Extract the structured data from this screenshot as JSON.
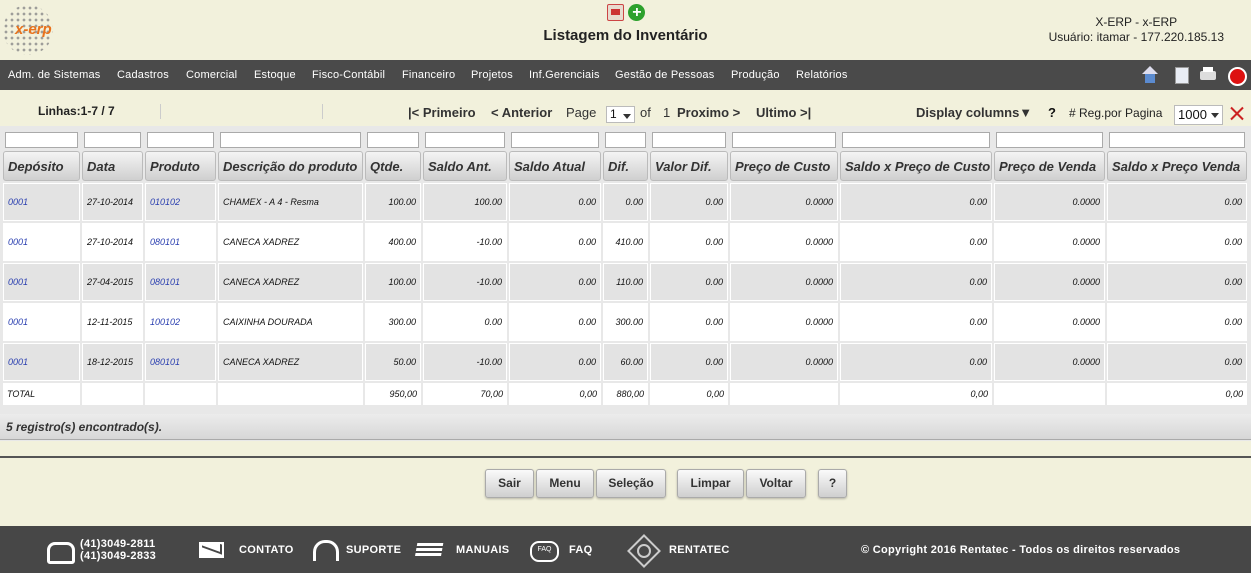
{
  "header": {
    "brand": "x-erp",
    "title": "Listagem do Inventário",
    "user_line1": "X-ERP - x-ERP",
    "user_line2": "Usuário: itamar - 177.220.185.13"
  },
  "menu": [
    "Adm. de Sistemas",
    "Cadastros",
    "Comercial",
    "Estoque",
    "Fisco-Contábil",
    "Financeiro",
    "Projetos",
    "Inf.Gerenciais",
    "Gestão de Pessoas",
    "Produção",
    "Relatórios"
  ],
  "pager": {
    "lines": "Linhas:1-7 / 7",
    "first": "|< Primeiro",
    "prev": "< Anterior",
    "page_label": "Page",
    "page_value": "1",
    "of_label": "of",
    "total_pages": "1",
    "next": "Proximo >",
    "last": "Ultimo >|",
    "display_columns": "Display columns▼",
    "help": "?",
    "reg_label": "# Reg.por Pagina",
    "reg_value": "1000"
  },
  "columns": [
    "Depósito",
    "Data",
    "Produto",
    "Descrição do produto",
    "Qtde.",
    "Saldo Ant.",
    "Saldo Atual",
    "Dif.",
    "Valor Dif.",
    "Preço de Custo",
    "Saldo x Preço de Custo",
    "Preço de Venda",
    "Saldo x Preço Venda"
  ],
  "rows": [
    [
      "0001",
      "27-10-2014",
      "010102",
      "CHAMEX - A 4 - Resma",
      "100.00",
      "100.00",
      "0.00",
      "0.00",
      "0.00",
      "0.0000",
      "0.00",
      "0.0000",
      "0.00"
    ],
    [
      "0001",
      "27-10-2014",
      "080101",
      "CANECA XADREZ",
      "400.00",
      "-10.00",
      "0.00",
      "410.00",
      "0.00",
      "0.0000",
      "0.00",
      "0.0000",
      "0.00"
    ],
    [
      "0001",
      "27-04-2015",
      "080101",
      "CANECA XADREZ",
      "100.00",
      "-10.00",
      "0.00",
      "110.00",
      "0.00",
      "0.0000",
      "0.00",
      "0.0000",
      "0.00"
    ],
    [
      "0001",
      "12-11-2015",
      "100102",
      "CAIXINHA DOURADA",
      "300.00",
      "0.00",
      "0.00",
      "300.00",
      "0.00",
      "0.0000",
      "0.00",
      "0.0000",
      "0.00"
    ],
    [
      "0001",
      "18-12-2015",
      "080101",
      "CANECA XADREZ",
      "50.00",
      "-10.00",
      "0.00",
      "60.00",
      "0.00",
      "0.0000",
      "0.00",
      "0.0000",
      "0.00"
    ]
  ],
  "totals": [
    "TOTAL",
    "",
    "",
    "",
    "950,00",
    "70,00",
    "0,00",
    "880,00",
    "0,00",
    "",
    "0,00",
    "",
    "0,00"
  ],
  "found": "5 registro(s) encontrado(s).",
  "buttons": {
    "sair": "Sair",
    "menu": "Menu",
    "selecao": "Seleção",
    "limpar": "Limpar",
    "voltar": "Voltar",
    "help": "?"
  },
  "footer": {
    "phone1": "(41)3049-2811",
    "phone2": "(41)3049-2833",
    "contato": "CONTATO",
    "suporte": "SUPORTE",
    "manuais": "MANUAIS",
    "faq": "FAQ",
    "rentatec": "RENTATEC",
    "copyright": "© Copyright 2016 Rentatec - Todos os direitos reservados"
  },
  "colors": {
    "menubar": "#4a4a4a",
    "background": "#f2f1dc",
    "link": "#2a3fb0",
    "footer": "#474747"
  },
  "icons": [
    "pdf-icon",
    "add-icon",
    "home-icon",
    "document-icon",
    "print-icon",
    "exit-icon",
    "clear-filter-icon",
    "phone-icon",
    "mail-icon",
    "headset-icon",
    "books-icon",
    "faq-icon",
    "globe-icon"
  ]
}
